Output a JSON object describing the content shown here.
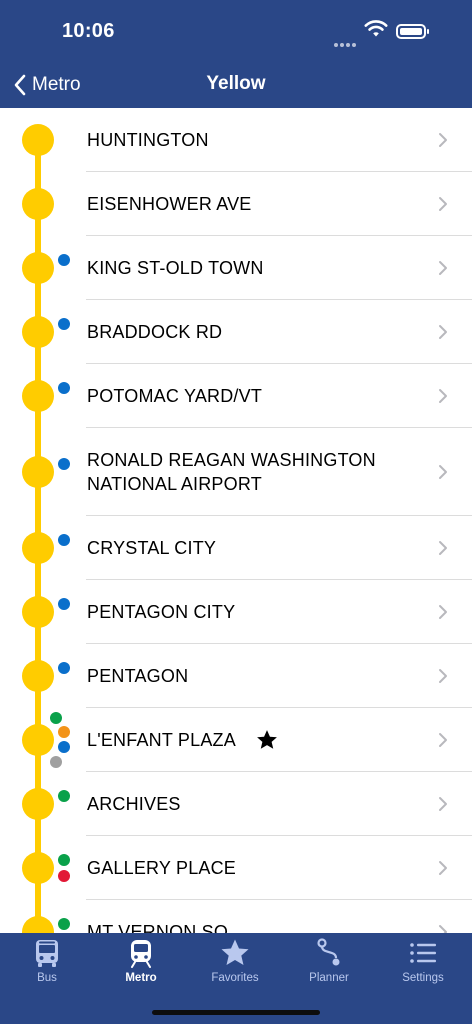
{
  "status": {
    "time": "10:06"
  },
  "nav": {
    "back_label": "Metro",
    "title": "Yellow"
  },
  "line_color": "#ffcc00",
  "transfer_colors": {
    "blue": "#0a6fcb",
    "green": "#0aa14a",
    "orange": "#f39419",
    "silver": "#a0a0a0",
    "red": "#e21836"
  },
  "stations": [
    {
      "name": "HUNTINGTON",
      "transfers": []
    },
    {
      "name": "EISENHOWER AVE",
      "transfers": []
    },
    {
      "name": "KING ST-OLD TOWN",
      "transfers": [
        "blue"
      ]
    },
    {
      "name": "BRADDOCK RD",
      "transfers": [
        "blue"
      ]
    },
    {
      "name": "POTOMAC YARD/VT",
      "transfers": [
        "blue"
      ]
    },
    {
      "name_line1": "RONALD REAGAN WASHINGTON",
      "name_line2": "NATIONAL AIRPORT",
      "transfers": [
        "blue"
      ]
    },
    {
      "name": "CRYSTAL CITY",
      "transfers": [
        "blue"
      ]
    },
    {
      "name": "PENTAGON CITY",
      "transfers": [
        "blue"
      ]
    },
    {
      "name": "PENTAGON",
      "transfers": [
        "blue"
      ]
    },
    {
      "name": "L'ENFANT PLAZA",
      "transfers": [
        "green",
        "orange",
        "blue",
        "silver"
      ],
      "favorite": true
    },
    {
      "name": "ARCHIVES",
      "transfers": [
        "green"
      ]
    },
    {
      "name": "GALLERY PLACE",
      "transfers": [
        "green",
        "red"
      ]
    },
    {
      "name": "MT VERNON SQ",
      "transfers": [
        "green"
      ]
    }
  ],
  "tabs": [
    {
      "label": "Bus",
      "icon": "bus-icon",
      "active": false
    },
    {
      "label": "Metro",
      "icon": "metro-train-icon",
      "active": true
    },
    {
      "label": "Favorites",
      "icon": "star-icon",
      "active": false
    },
    {
      "label": "Planner",
      "icon": "route-icon",
      "active": false
    },
    {
      "label": "Settings",
      "icon": "list-icon",
      "active": false
    }
  ]
}
